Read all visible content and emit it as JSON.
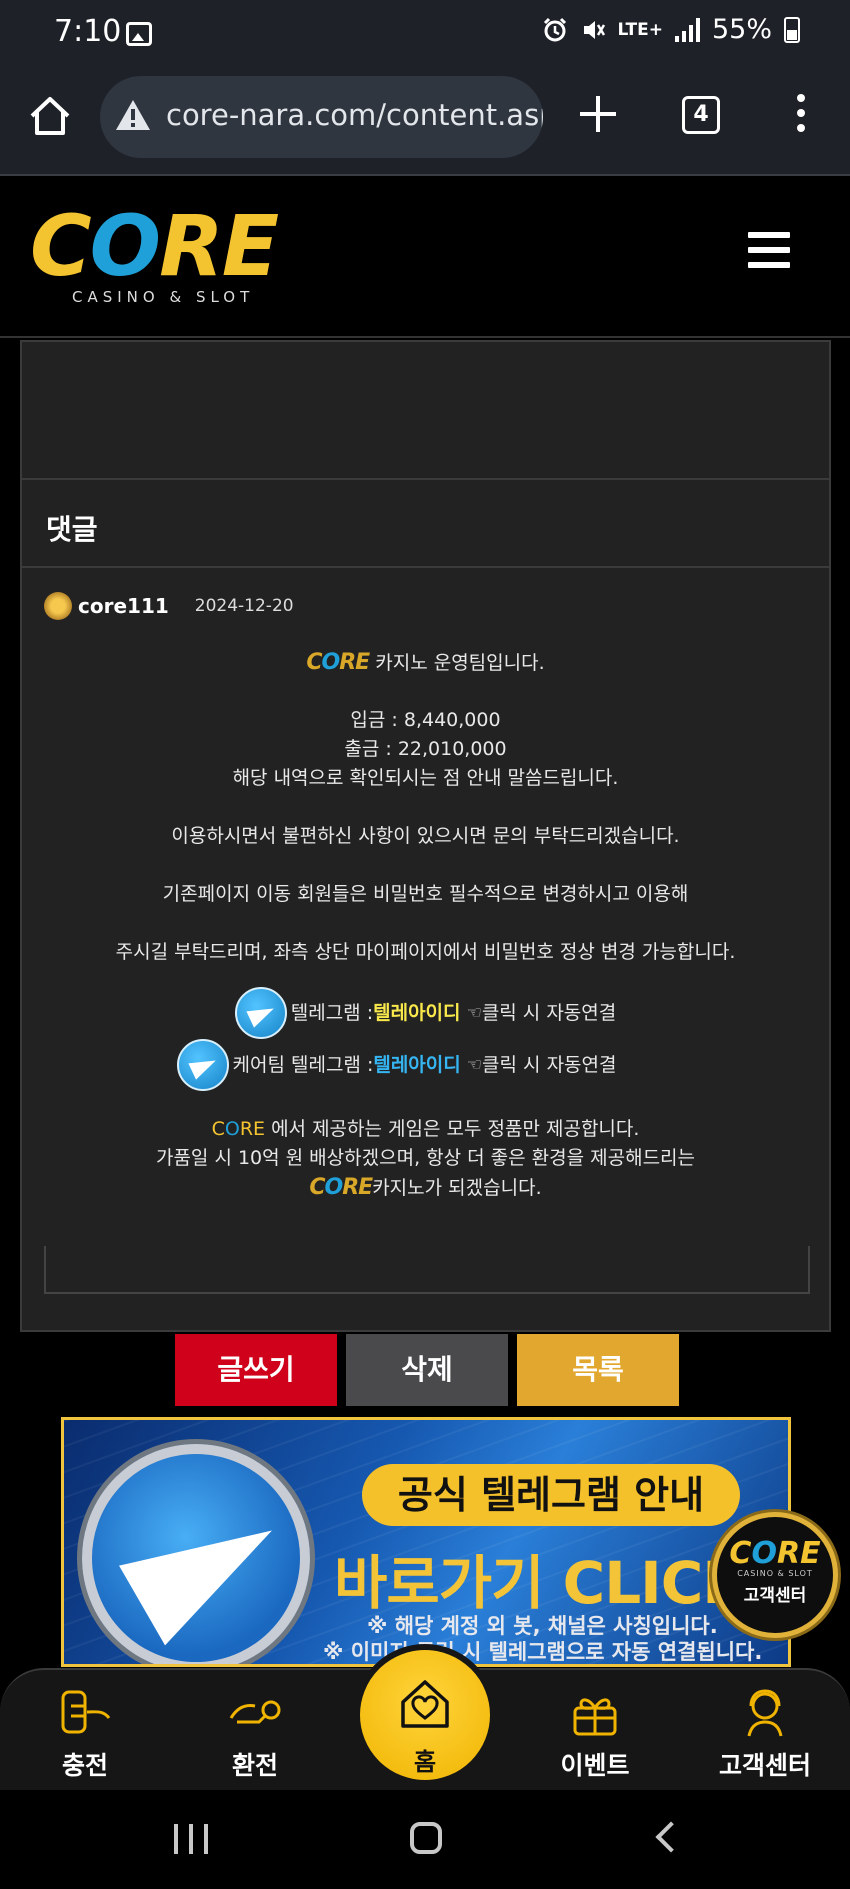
{
  "status": {
    "time": "7:10",
    "network": "LTE+",
    "battery": "55%"
  },
  "browser": {
    "url": "core-nara.com/content.asp",
    "tab_count": "4"
  },
  "header": {
    "logo_word_c": "C",
    "logo_word_o": "O",
    "logo_word_re": "RE",
    "logo_sub": "CASINO & SLOT"
  },
  "post": {
    "comment_heading": "댓글",
    "author": "core111",
    "date": "2024-12-20",
    "mini_logo_c": "C",
    "mini_logo_o": "O",
    "mini_logo_re": "RE",
    "intro": "카지노 운영팀입니다.",
    "deposit": "입금 : 8,440,000",
    "withdraw": "출금 : 22,010,000",
    "confirm": "해당 내역으로 확인되시는 점 안내 말씀드립니다.",
    "inquiry": "이용하시면서 불편하신 사항이 있으시면 문의 부탁드리겠습니다.",
    "password1": "기존페이지 이동 회원들은 비밀번호 필수적으로 변경하시고 이용해",
    "password2": "주시길 부탁드리며, 좌측 상단 마이페이지에서 비밀번호 정상 변경 가능합니다.",
    "tg1_prefix": "텔레그램 : ",
    "tg1_id": "텔레아이디",
    "tg1_suffix": " 클릭 시 자동연결",
    "tg2_prefix": "케어팀 텔레그램 : ",
    "tg2_id": "텔레아이디",
    "tg2_suffix": " 클릭 시 자동연결",
    "pointer_glyph": "☜",
    "core_c": "C",
    "core_o": "O",
    "core_re": "RE",
    "genuine": " 에서 제공하는 게임은 모두 정품만 제공합니다.",
    "fake": "가품일 시 10억 원 배상하겠으며, 항상 더 좋은 환경을 제공해드리는",
    "closing_suffix": "카지노가 되겠습니다."
  },
  "actions": {
    "write": "글쓰기",
    "delete": "삭제",
    "list": "목록"
  },
  "banner": {
    "pill": "공식 텔레그램 안내",
    "main": "바로가기 CLICK",
    "note1": "※ 해당 계정 외 봇, 채널은 사칭입니다.",
    "note2": "※ 이미지 클릭 시 텔레그램으로 자동 연결됩니다."
  },
  "cs_badge": {
    "word_c": "C",
    "word_o": "O",
    "word_re": "RE",
    "sub": "CASINO & SLOT",
    "label": "고객센터"
  },
  "bottom_nav": {
    "charge": "충전",
    "exchange": "환전",
    "home": "홈",
    "event": "이벤트",
    "support": "고객센터"
  },
  "colors": {
    "brand_gold": "#f4c430",
    "brand_blue": "#1fa0d8",
    "write_red": "#d0021b",
    "delete_gray": "#4a4a4c",
    "list_gold": "#e2a72e"
  },
  "icons": {
    "home": "home-icon",
    "warning": "warning-icon",
    "menu": "hamburger-icon",
    "telegram": "telegram-icon"
  }
}
